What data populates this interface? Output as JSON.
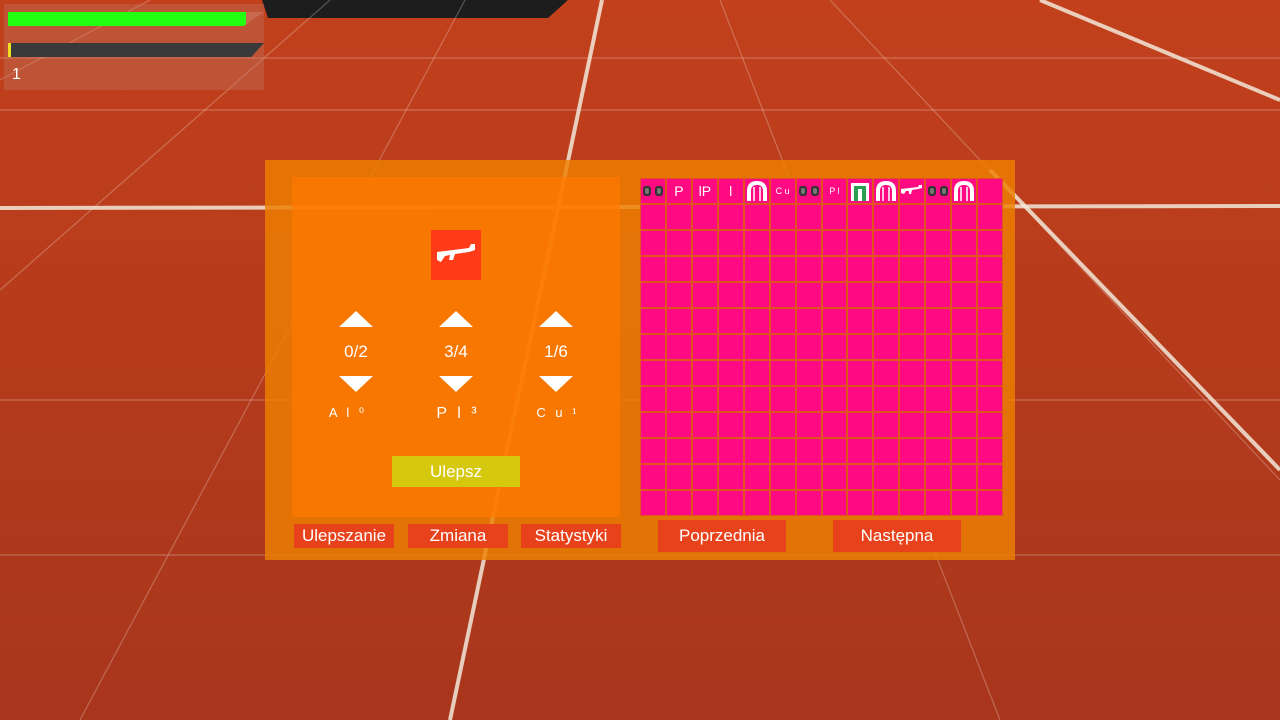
{
  "hud": {
    "health_fraction": 0.93,
    "xp_fraction": 0.01,
    "level": "1"
  },
  "upgrade_panel": {
    "weapon_icon": "rifle-icon",
    "stats": [
      {
        "value": "0/2",
        "name": "A l ⁰"
      },
      {
        "value": "3/4",
        "name": "P l ³"
      },
      {
        "value": "1/6",
        "name": "C u ¹"
      }
    ],
    "upgrade_button": "Ulepsz"
  },
  "tabs": [
    "Ulepszanie",
    "Zmiana",
    "Statystyki"
  ],
  "inventory": {
    "columns": 14,
    "rows": 13,
    "items": [
      {
        "icon": "goggles-icon",
        "text": ""
      },
      {
        "icon": "",
        "text": "P"
      },
      {
        "icon": "",
        "text": "lP"
      },
      {
        "icon": "",
        "text": "l"
      },
      {
        "icon": "arch-icon",
        "text": ""
      },
      {
        "icon": "",
        "text": "C u"
      },
      {
        "icon": "goggles-icon",
        "text": ""
      },
      {
        "icon": "",
        "text": "P l"
      },
      {
        "icon": "green-gate-icon",
        "text": ""
      },
      {
        "icon": "arch-icon",
        "text": ""
      },
      {
        "icon": "rifle-icon",
        "text": ""
      },
      {
        "icon": "goggles-icon",
        "text": ""
      },
      {
        "icon": "arch-icon",
        "text": ""
      }
    ]
  },
  "nav": {
    "prev_label": "Poprzednia",
    "next_label": "Następna"
  },
  "colors": {
    "floor": "#b23a1c",
    "panel": "#ee8000",
    "cell": "#ff0a82",
    "button": "#e8421c",
    "upgrade_button": "#d6c80c",
    "health": "#22ff11"
  }
}
